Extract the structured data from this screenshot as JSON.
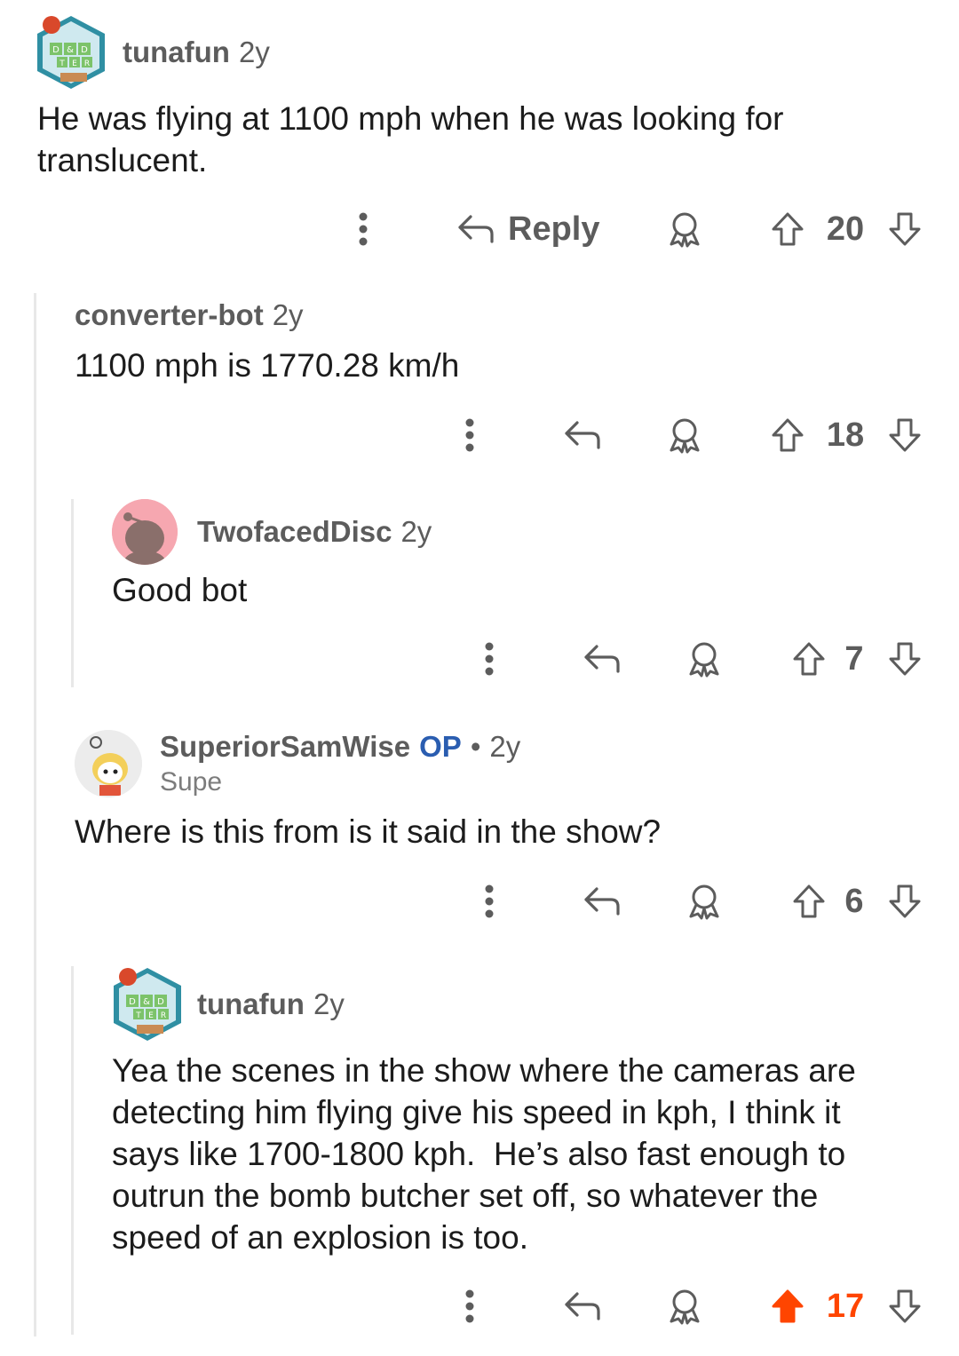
{
  "comments": [
    {
      "username": "tunafun",
      "age": "2y",
      "body": "He was flying at 1100 mph when he was looking for\ntranslucent.",
      "reply_label": "Reply",
      "votes": "20",
      "upvoted": false
    },
    {
      "username": "converter-bot",
      "age": "2y",
      "body": "1100 mph is 1770.28 km/h",
      "votes": "18",
      "upvoted": false
    },
    {
      "username": "TwofacedDisc",
      "age": "2y",
      "body": "Good bot",
      "votes": "7",
      "upvoted": false
    },
    {
      "username": "SuperiorSamWise",
      "op_badge": "OP",
      "separator": "•",
      "age": "2y",
      "flair": "Supe",
      "body": "Where is this from is it said in the show?",
      "votes": "6",
      "upvoted": false
    },
    {
      "username": "tunafun",
      "age": "2y",
      "body": "Yea the scenes in the show where the cameras are\ndetecting him flying give his speed in kph, I think it\nsays like 1700-1800 kph.  He’s also fast enough to\noutrun the bomb butcher set off, so whatever the\nspeed of an explosion is too.",
      "votes": "17",
      "upvoted": true
    }
  ],
  "avatar_labels": {
    "tile_1": "D",
    "tile_2": "&",
    "tile_3": "D",
    "tile_4": "T",
    "tile_5": "E",
    "tile_6": "R"
  },
  "colors": {
    "accent_upvote": "#ff4500",
    "op_blue": "#2a5db0",
    "meta_gray": "#5c5c5c",
    "thread_line": "#e8e8e8"
  },
  "icons": [
    "more-icon",
    "reply-arrow-icon",
    "award-icon",
    "upvote-icon",
    "downvote-icon"
  ]
}
